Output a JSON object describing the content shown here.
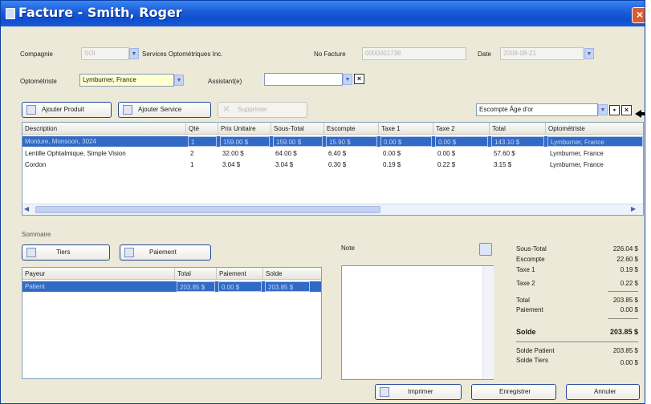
{
  "window": {
    "title": "Facture - Smith, Roger",
    "close_glyph": "×"
  },
  "header": {
    "compagnie_label": "Compagnie",
    "compagnie_value": "SOI",
    "compagnie_name": "Services Optométriques Inc.",
    "no_facture_label": "No Facture",
    "no_facture_value": "0000001738",
    "date_label": "Date",
    "date_value": "2008-08-21",
    "optometriste_label": "Optométriste",
    "optometriste_value": "Lymburner, France",
    "assistant_label": "Assistant(e)",
    "assistant_value": ""
  },
  "toolbar": {
    "add_product": "Ajouter Produit",
    "add_service": "Ajouter Service",
    "delete": "Supprimer",
    "discount_value": "Escompte Âge d'or"
  },
  "items": {
    "columns": [
      "Description",
      "Qté",
      "Prix Unitaire",
      "Sous-Total",
      "Escompte",
      "Taxe 1",
      "Taxe 2",
      "Total",
      "Optométriste"
    ],
    "rows": [
      [
        "Monture, Monsoon, 3024",
        "1",
        "159.00 $",
        "159.00 $",
        "15.90 $",
        "0.00 $",
        "0.00 $",
        "143.10 $",
        "Lymburner, France"
      ],
      [
        "Lentille Ophtalmique, Simple Vision",
        "2",
        "32.00 $",
        "64.00 $",
        "6.40 $",
        "0.00 $",
        "0.00 $",
        "57.60 $",
        "Lymburner, France"
      ],
      [
        "Cordon",
        "1",
        "3.04 $",
        "3.04 $",
        "0.30 $",
        "0.19 $",
        "0.22 $",
        "3.15 $",
        "Lymburner, France"
      ]
    ]
  },
  "sommaire": {
    "label": "Sommaire",
    "tiers_button": "Tiers",
    "paiement_button": "Paiement",
    "columns": [
      "Payeur",
      "Total",
      "Paiement",
      "Solde"
    ],
    "rows": [
      [
        "Patient",
        "203.85 $",
        "0.00 $",
        "203.85 $"
      ]
    ]
  },
  "note": {
    "label": "Note"
  },
  "totals": {
    "sous_total_label": "Sous-Total",
    "sous_total": "226.04 $",
    "escompte_label": "Escompte",
    "escompte": "22.60 $",
    "taxe1_label": "Taxe 1",
    "taxe1": "0.19 $",
    "taxe2_label": "Taxe 2",
    "taxe2": "0.22 $",
    "total_label": "Total",
    "total": "203.85 $",
    "paiement_label": "Paiement",
    "paiement": "0.00 $",
    "solde_label": "Solde",
    "solde": "203.85 $",
    "solde_patient_label": "Solde Patient",
    "solde_patient": "203.85 $",
    "solde_tiers_label": "Solde Tiers",
    "solde_tiers": "0.00 $"
  },
  "footer": {
    "print": "Imprimer",
    "save": "Enregistrer",
    "cancel": "Annuler"
  },
  "colors": {
    "title_bar": "#0d4ed0",
    "selection": "#316ac5",
    "window_bg": "#ece9d8"
  }
}
